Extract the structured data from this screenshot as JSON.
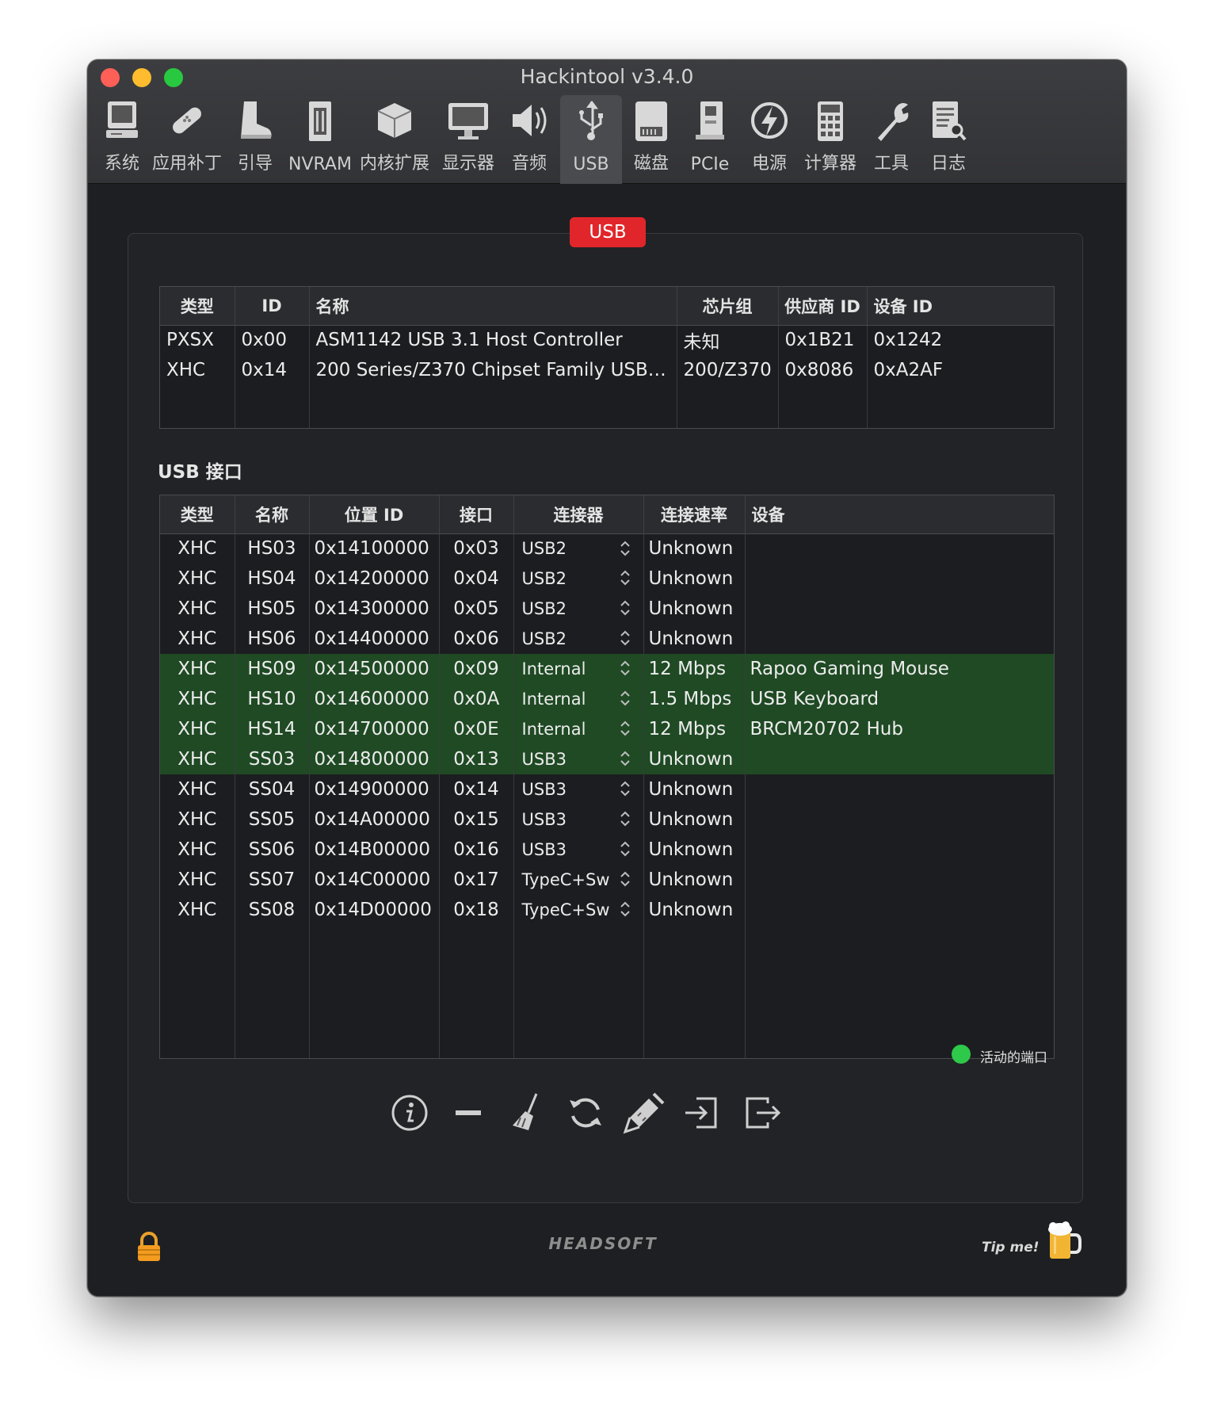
{
  "window": {
    "title": "Hackintool v3.4.0"
  },
  "toolbar": {
    "items": [
      {
        "label": "系统",
        "icon": "computer-icon"
      },
      {
        "label": "应用补丁",
        "icon": "bandage-icon"
      },
      {
        "label": "引导",
        "icon": "boot-icon"
      },
      {
        "label": "NVRAM",
        "icon": "memory-chip-icon"
      },
      {
        "label": "内核扩展",
        "icon": "kext-box-icon"
      },
      {
        "label": "显示器",
        "icon": "display-icon"
      },
      {
        "label": "音频",
        "icon": "speaker-icon"
      },
      {
        "label": "USB",
        "icon": "usb-icon",
        "active": true
      },
      {
        "label": "磁盘",
        "icon": "disk-icon"
      },
      {
        "label": "PCIe",
        "icon": "pcie-card-icon"
      },
      {
        "label": "电源",
        "icon": "power-bolt-icon"
      },
      {
        "label": "计算器",
        "icon": "calculator-icon"
      },
      {
        "label": "工具",
        "icon": "wrench-icon"
      },
      {
        "label": "日志",
        "icon": "log-document-icon"
      }
    ]
  },
  "panel": {
    "badge": "USB"
  },
  "controllers": {
    "headers": [
      "类型",
      "ID",
      "名称",
      "芯片组",
      "供应商 ID",
      "设备 ID"
    ],
    "rows": [
      [
        "PXSX",
        "0x00",
        "ASM1142 USB 3.1 Host Controller",
        "未知",
        "0x1B21",
        "0x1242"
      ],
      [
        "XHC",
        "0x14",
        "200 Series/Z370 Chipset Family USB 3.0 x...",
        "200/Z370",
        "0x8086",
        "0xA2AF"
      ]
    ]
  },
  "ports": {
    "section_title": "USB 接口",
    "headers": [
      "类型",
      "名称",
      "位置 ID",
      "接口",
      "连接器",
      "连接速率",
      "设备"
    ],
    "rows": [
      {
        "type": "XHC",
        "name": "HS03",
        "location": "0x14100000",
        "port": "0x03",
        "connector": "USB2",
        "speed": "Unknown",
        "device": "",
        "active": false
      },
      {
        "type": "XHC",
        "name": "HS04",
        "location": "0x14200000",
        "port": "0x04",
        "connector": "USB2",
        "speed": "Unknown",
        "device": "",
        "active": false
      },
      {
        "type": "XHC",
        "name": "HS05",
        "location": "0x14300000",
        "port": "0x05",
        "connector": "USB2",
        "speed": "Unknown",
        "device": "",
        "active": false
      },
      {
        "type": "XHC",
        "name": "HS06",
        "location": "0x14400000",
        "port": "0x06",
        "connector": "USB2",
        "speed": "Unknown",
        "device": "",
        "active": false
      },
      {
        "type": "XHC",
        "name": "HS09",
        "location": "0x14500000",
        "port": "0x09",
        "connector": "Internal",
        "speed": "12 Mbps",
        "device": "Rapoo Gaming Mouse",
        "active": true
      },
      {
        "type": "XHC",
        "name": "HS10",
        "location": "0x14600000",
        "port": "0x0A",
        "connector": "Internal",
        "speed": "1.5 Mbps",
        "device": "USB Keyboard",
        "active": true
      },
      {
        "type": "XHC",
        "name": "HS14",
        "location": "0x14700000",
        "port": "0x0E",
        "connector": "Internal",
        "speed": "12 Mbps",
        "device": "BRCM20702 Hub",
        "active": true
      },
      {
        "type": "XHC",
        "name": "SS03",
        "location": "0x14800000",
        "port": "0x13",
        "connector": "USB3",
        "speed": "Unknown",
        "device": "",
        "active": true
      },
      {
        "type": "XHC",
        "name": "SS04",
        "location": "0x14900000",
        "port": "0x14",
        "connector": "USB3",
        "speed": "Unknown",
        "device": "",
        "active": false
      },
      {
        "type": "XHC",
        "name": "SS05",
        "location": "0x14A00000",
        "port": "0x15",
        "connector": "USB3",
        "speed": "Unknown",
        "device": "",
        "active": false
      },
      {
        "type": "XHC",
        "name": "SS06",
        "location": "0x14B00000",
        "port": "0x16",
        "connector": "USB3",
        "speed": "Unknown",
        "device": "",
        "active": false
      },
      {
        "type": "XHC",
        "name": "SS07",
        "location": "0x14C00000",
        "port": "0x17",
        "connector": "TypeC+Sw",
        "speed": "Unknown",
        "device": "",
        "active": false
      },
      {
        "type": "XHC",
        "name": "SS08",
        "location": "0x14D00000",
        "port": "0x18",
        "connector": "TypeC+Sw",
        "speed": "Unknown",
        "device": "",
        "active": false
      }
    ],
    "active_row_color": "#1f4a24"
  },
  "legend": {
    "label": "活动的端口",
    "color": "#2ec84a"
  },
  "actions": [
    {
      "icon": "info-icon"
    },
    {
      "icon": "minus-icon"
    },
    {
      "icon": "broom-icon"
    },
    {
      "icon": "refresh-icon"
    },
    {
      "icon": "syringe-icon"
    },
    {
      "icon": "import-icon"
    },
    {
      "icon": "export-icon"
    }
  ],
  "footer": {
    "brand": "HEADSOFT",
    "tip": "Tip me!",
    "lock_icon": "lock-icon",
    "beer_icon": "beer-icon"
  },
  "colors": {
    "badge": "#e0262b",
    "accent_green": "#2ec84a",
    "background": "#1e1f22"
  }
}
